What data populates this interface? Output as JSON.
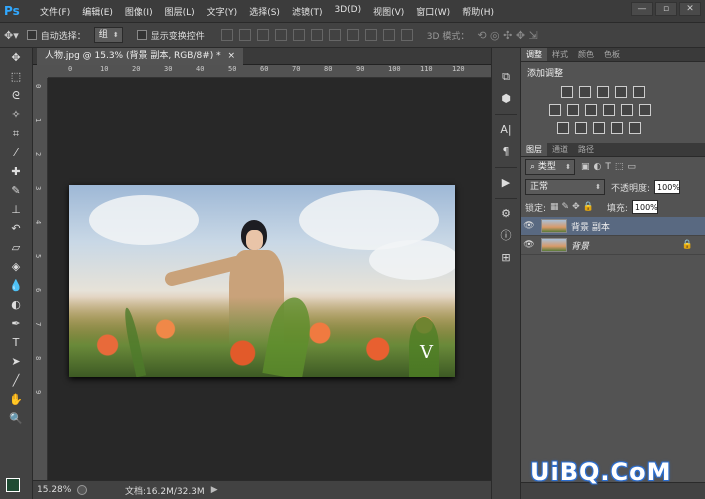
{
  "app": {
    "logo": "Ps"
  },
  "menu": [
    "文件(F)",
    "编辑(E)",
    "图像(I)",
    "图层(L)",
    "文字(Y)",
    "选择(S)",
    "滤镜(T)",
    "3D(D)",
    "视图(V)",
    "窗口(W)",
    "帮助(H)"
  ],
  "window_buttons": [
    "—",
    "▫",
    "✕"
  ],
  "options": {
    "auto_select_label": "自动选择：",
    "auto_select_value": "组",
    "show_transform_label": "显示变换控件",
    "mode_3d_label": "3D 模式："
  },
  "document": {
    "tab_title": "人物.jpg @ 15.3% (背景 副本, RGB/8#) *",
    "close": "×",
    "watermark_letter": "V"
  },
  "ruler_h": [
    "0",
    "10",
    "20",
    "30",
    "40",
    "50",
    "60",
    "70",
    "80",
    "90",
    "100",
    "110",
    "120"
  ],
  "ruler_v": [
    "0",
    "1",
    "2",
    "3",
    "4",
    "5",
    "6",
    "7",
    "8",
    "9"
  ],
  "status": {
    "zoom": "15.28%",
    "doc_info": "文档:16.2M/32.3M",
    "arrow": "▶"
  },
  "adjust_panel": {
    "tabs": [
      "调整",
      "样式",
      "颜色",
      "色板"
    ],
    "title": "添加调整"
  },
  "layers_panel": {
    "tabs": [
      "图层",
      "通道",
      "路径"
    ],
    "filter_kind": "类型",
    "blend_mode": "正常",
    "opacity_label": "不透明度:",
    "opacity_value": "100%",
    "lock_label": "锁定:",
    "fill_label": "填充:",
    "fill_value": "100%",
    "layers": [
      {
        "name": "背景 副本",
        "visible_icon": "👁"
      },
      {
        "name": "背景",
        "visible_icon": "👁",
        "lock_icon": "🔒"
      }
    ]
  },
  "site_watermark": "UiBQ.CoM"
}
